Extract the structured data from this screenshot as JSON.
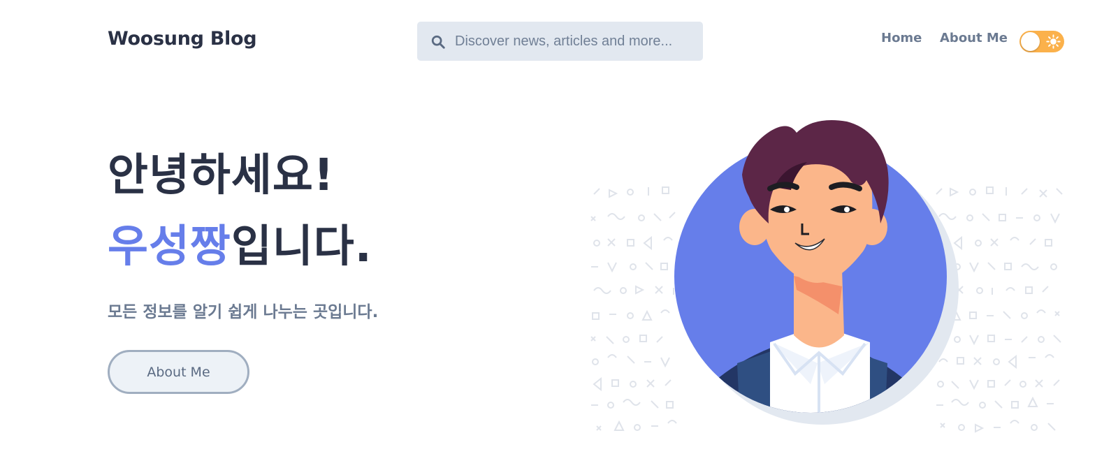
{
  "header": {
    "logo": "Woosung Blog",
    "search": {
      "placeholder": "Discover news, articles and more..."
    },
    "nav": {
      "home": "Home",
      "about": "About Me"
    },
    "theme_toggle": {
      "icon": "sun-icon",
      "state": "light"
    }
  },
  "hero": {
    "greeting": "안녕하세요!",
    "name": "우성짱",
    "name_suffix": "입니다.",
    "subtitle": "모든 정보를 알기 쉽게 나누는 곳입니다.",
    "cta_label": "About Me"
  },
  "colors": {
    "accent": "#667eea",
    "text_dark": "#2a3145",
    "text_muted": "#6b7a91",
    "search_bg": "#e2e8f0",
    "toggle": "#fbb14b"
  }
}
